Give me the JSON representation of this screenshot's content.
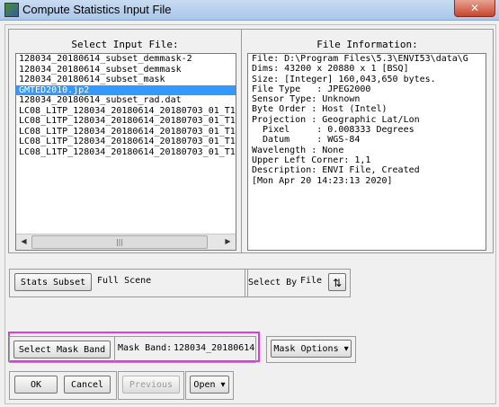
{
  "window": {
    "title": "Compute Statistics Input File",
    "close_label": "✕"
  },
  "input_panel": {
    "title": "Select Input File:",
    "items": [
      "128034_20180614_subset_demmask-2",
      "128034_20180614_subset_demmask",
      "128034_20180614_subset_mask",
      "GMTED2010.jp2",
      "128034_20180614_subset_rad.dat",
      "LC08_L1TP_128034_20180614_20180703_01_T1",
      "LC08_L1TP_128034_20180614_20180703_01_T1",
      "LC08_L1TP_128034_20180614_20180703_01_T1",
      "LC08_L1TP_128034_20180614_20180703_01_T1",
      "LC08_L1TP_128034_20180614_20180703_01_T1"
    ],
    "selected_index": 3,
    "scroll_left": "◀",
    "scroll_right": "▶",
    "scroll_grip": "|||"
  },
  "info_panel": {
    "title": "File Information:",
    "lines": [
      "File: D:\\Program Files\\5.3\\ENVI53\\data\\G",
      "Dims: 43200 x 20880 x 1 [BSQ]",
      "Size: [Integer] 160,043,650 bytes.",
      "File Type   : JPEG2000",
      "Sensor Type: Unknown",
      "Byte Order : Host (Intel)",
      "Projection : Geographic Lat/Lon",
      "  Pixel     : 0.008333 Degrees",
      "  Datum     : WGS-84",
      "Wavelength : None",
      "Upper Left Corner: 1,1",
      "Description: ENVI File, Created",
      "[Mon Apr 20 14:23:13 2020]"
    ]
  },
  "stats_subset": {
    "button_label": "Stats Subset",
    "value": "Full Scene"
  },
  "select_by": {
    "label": "Select By",
    "value": "File",
    "toggle_icon": "⇅"
  },
  "mask_band": {
    "button_label": "Select Mask Band",
    "label": "Mask Band:",
    "value": "128034_20180614",
    "options_label": "Mask Options",
    "options_arrow": "▾"
  },
  "footer": {
    "ok_label": "OK",
    "cancel_label": "Cancel",
    "previous_label": "Previous",
    "open_label": "Open",
    "open_arrow": "▾"
  },
  "colors": {
    "selection": "#3399ff",
    "highlight": "#e238e2"
  }
}
